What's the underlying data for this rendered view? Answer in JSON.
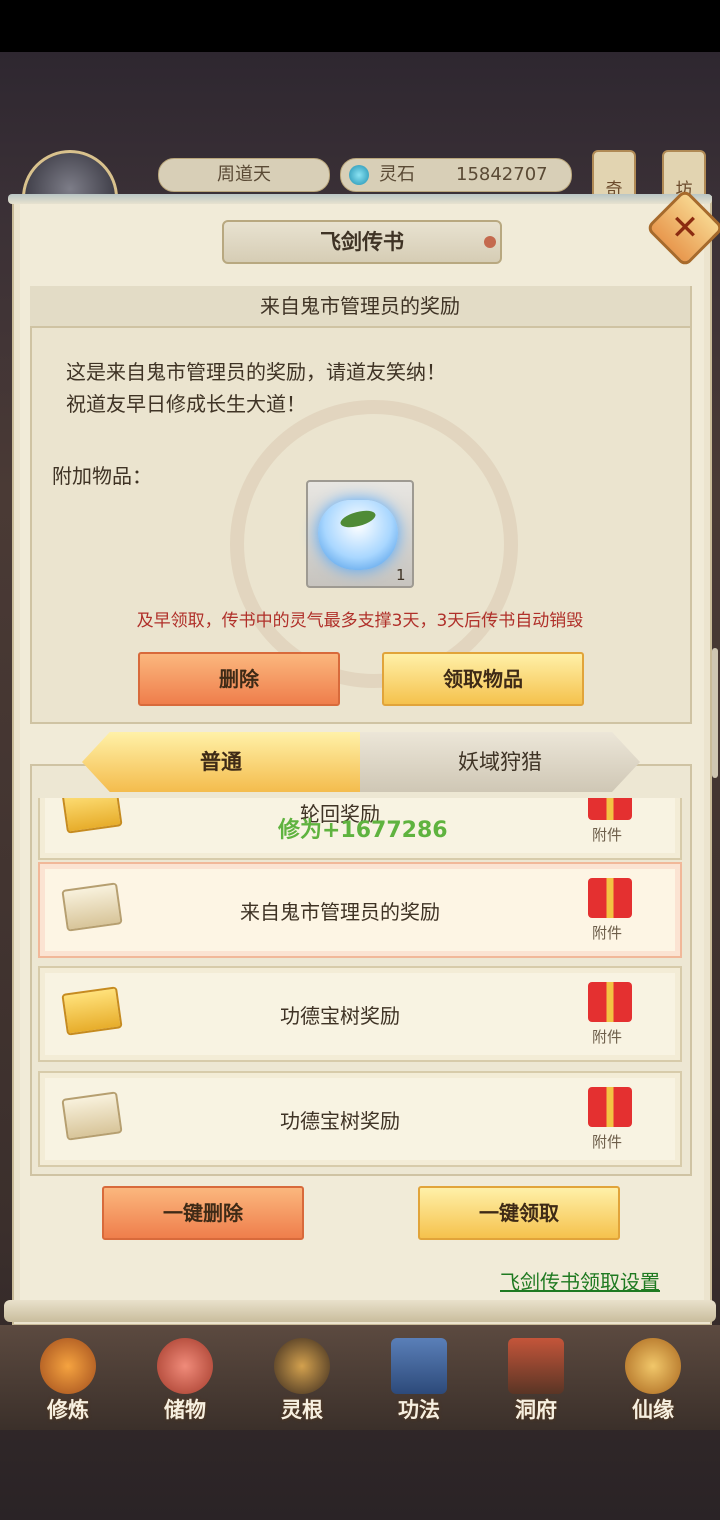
{
  "header": {
    "player_name": "周道天",
    "currency_label": "灵石",
    "currency_value": "15842707",
    "side_tabs": [
      "奇",
      "坊"
    ]
  },
  "panel": {
    "title": "飞剑传书",
    "close_label": "✕"
  },
  "mail": {
    "subject": "来自鬼市管理员的奖励",
    "body_line1": "这是来自鬼市管理员的奖励，请道友笑纳！",
    "body_line2": "祝道友早日修成长生大道！",
    "attachments_label": "附加物品：",
    "attachment_item_icon": "spirit-tea-bowl-icon",
    "attachment_count": "1",
    "warning": "及早领取，传书中的灵气最多支撑3天，3天后传书自动销毁",
    "delete_label": "删除",
    "claim_label": "领取物品"
  },
  "tabs": [
    {
      "label": "普通",
      "active": true
    },
    {
      "label": "妖域狩猎",
      "active": false
    }
  ],
  "mail_list": [
    {
      "title": "轮回奖励",
      "attachment_label": "附件",
      "envelope": "gold",
      "overlay": "修为+1677286"
    },
    {
      "title": "来自鬼市管理员的奖励",
      "attachment_label": "附件",
      "envelope": "open",
      "selected": true
    },
    {
      "title": "功德宝树奖励",
      "attachment_label": "附件",
      "envelope": "gold"
    },
    {
      "title": "功德宝树奖励",
      "attachment_label": "附件",
      "envelope": "open"
    }
  ],
  "actions": {
    "delete_all_label": "一键删除",
    "claim_all_label": "一键领取",
    "settings_link": "飞剑传书领取设置"
  },
  "nav": [
    {
      "label": "修炼",
      "icon": "meditating-monk-icon"
    },
    {
      "label": "储物",
      "icon": "treasure-bag-icon"
    },
    {
      "label": "灵根",
      "icon": "spirit-root-icon"
    },
    {
      "label": "功法",
      "icon": "scripture-book-icon"
    },
    {
      "label": "洞府",
      "icon": "cave-mansion-icon"
    },
    {
      "label": "仙缘",
      "icon": "gourd-icon"
    }
  ],
  "colors": {
    "warning": "#b0302a",
    "xp_text": "#5fb33f",
    "settings_link": "#1f7a21",
    "button_red": "#ef7e4c",
    "button_gold": "#f5c24d"
  }
}
